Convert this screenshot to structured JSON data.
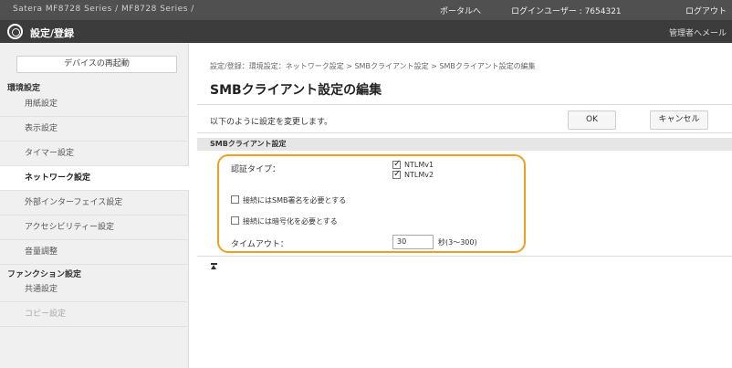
{
  "header": {
    "crumb": "Satera   MF8728 Series / MF8728 Series /",
    "portal_link": "ポータルへ",
    "user_info": "ログインユーザー : 7654321",
    "logout": "ログアウト"
  },
  "titlebar": {
    "title": "設定/登録",
    "admin_mail": "管理者へメール"
  },
  "sidebar": {
    "top_button": "デバイスの再起動",
    "sections": [
      {
        "label": "環境設定"
      },
      {
        "label": "ファンクション設定"
      }
    ],
    "items": [
      {
        "label": "用紙設定"
      },
      {
        "label": "表示設定"
      },
      {
        "label": "タイマー設定"
      },
      {
        "label": "ネットワーク設定"
      },
      {
        "label": "外部インターフェイス設定"
      },
      {
        "label": "アクセシビリティー設定"
      },
      {
        "label": "音量調整"
      },
      {
        "label": "共通設定"
      },
      {
        "label": "コピー設定"
      }
    ]
  },
  "main": {
    "breadcrumb": "設定/登録：環境設定：ネットワーク設定 > SMBクライアント設定 > SMBクライアント設定の編集",
    "title": "SMBクライアント設定の編集",
    "instruction": "以下のように設定を変更します。",
    "ok_label": "OK",
    "cancel_label": "キャンセル",
    "section_title": "SMBクライアント設定",
    "auth_type_label": "認証タイプ：",
    "ntlmv1": {
      "label": "NTLMv1",
      "checked": true
    },
    "ntlmv2": {
      "label": "NTLMv2",
      "checked": true
    },
    "require_signing": {
      "label": "接続にはSMB署名を必要とする",
      "checked": false
    },
    "require_encryption": {
      "label": "接続には暗号化を必要とする",
      "checked": false
    },
    "timeout_label": "タイムアウト：",
    "timeout_value": "30",
    "timeout_unit": "秒(3〜300)"
  },
  "colors": {
    "highlight": "#f0a020",
    "topbar": "#505050",
    "titlebar": "#3c3c3c"
  }
}
